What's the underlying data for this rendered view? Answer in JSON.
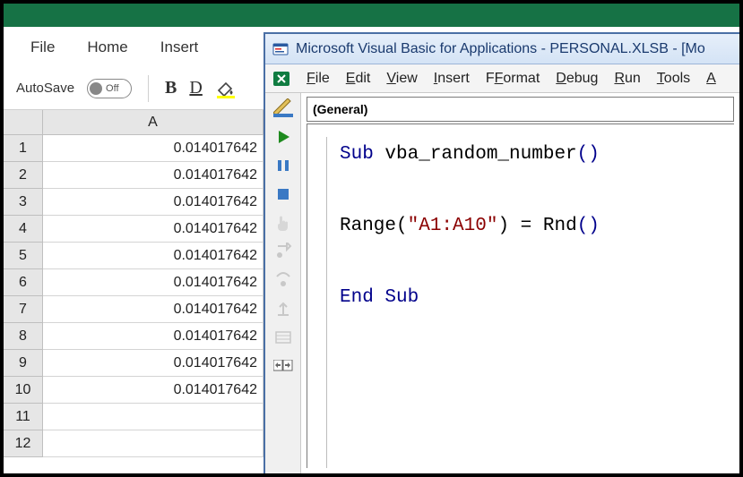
{
  "excel": {
    "tabs": {
      "file": "File",
      "home": "Home",
      "insert": "Insert"
    },
    "toolbar": {
      "autosave_label": "AutoSave",
      "autosave_state": "Off",
      "bold": "B",
      "underline": "D"
    },
    "column_header": "A",
    "row_headers": [
      "1",
      "2",
      "3",
      "4",
      "5",
      "6",
      "7",
      "8",
      "9",
      "10",
      "11",
      "12"
    ],
    "cell_values": [
      "0.014017642",
      "0.014017642",
      "0.014017642",
      "0.014017642",
      "0.014017642",
      "0.014017642",
      "0.014017642",
      "0.014017642",
      "0.014017642",
      "0.014017642",
      "",
      ""
    ]
  },
  "vbe": {
    "title": "Microsoft Visual Basic for Applications - PERSONAL.XLSB - [Mo",
    "menu": {
      "file": "ile",
      "file_k": "F",
      "edit": "dit",
      "edit_k": "E",
      "view": "iew",
      "view_k": "V",
      "insert": "nsert",
      "insert_k": "I",
      "format": "ormat",
      "format_k": "F",
      "debug": "ebug",
      "debug_k": "D",
      "run": "un",
      "run_k": "R",
      "tools": "ools",
      "tools_k": "T",
      "addins": "A"
    },
    "dropdown": "(General)",
    "code": {
      "sub_kw": "Sub",
      "sub_name": " vba_random_number",
      "parens": "()",
      "range": "Range",
      "range_arg": "(\"A1:A10\")",
      "eq": " = ",
      "rnd": "Rnd",
      "rnd_p": "()",
      "end_sub": "End Sub"
    }
  }
}
